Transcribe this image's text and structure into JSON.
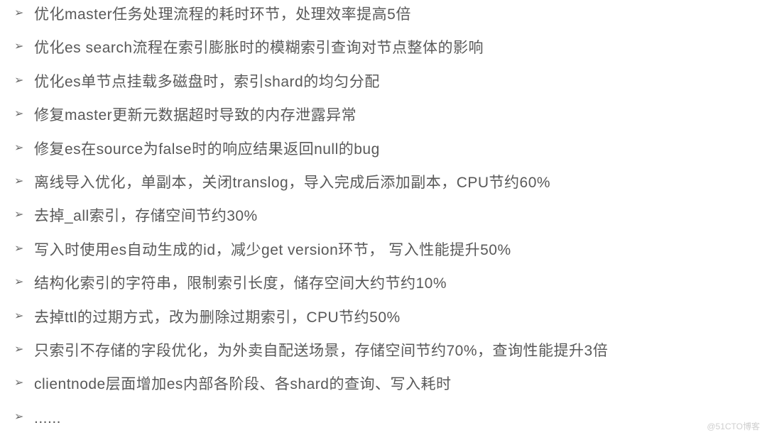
{
  "bullet": "➢",
  "items": [
    "优化master任务处理流程的耗时环节，处理效率提高5倍",
    "优化es search流程在索引膨胀时的模糊索引查询对节点整体的影响",
    "优化es单节点挂载多磁盘时，索引shard的均匀分配",
    "修复master更新元数据超时导致的内存泄露异常",
    "修复es在source为false时的响应结果返回null的bug",
    "离线导入优化，单副本，关闭translog，导入完成后添加副本，CPU节约60%",
    "去掉_all索引，存储空间节约30%",
    "写入时使用es自动生成的id，减少get version环节， 写入性能提升50%",
    "结构化索引的字符串，限制索引长度，储存空间大约节约10%",
    "去掉ttl的过期方式，改为删除过期索引，CPU节约50%",
    "只索引不存储的字段优化，为外卖自配送场景，存储空间节约70%，查询性能提升3倍",
    "clientnode层面增加es内部各阶段、各shard的查询、写入耗时",
    "......"
  ],
  "watermark": "@51CTO博客"
}
